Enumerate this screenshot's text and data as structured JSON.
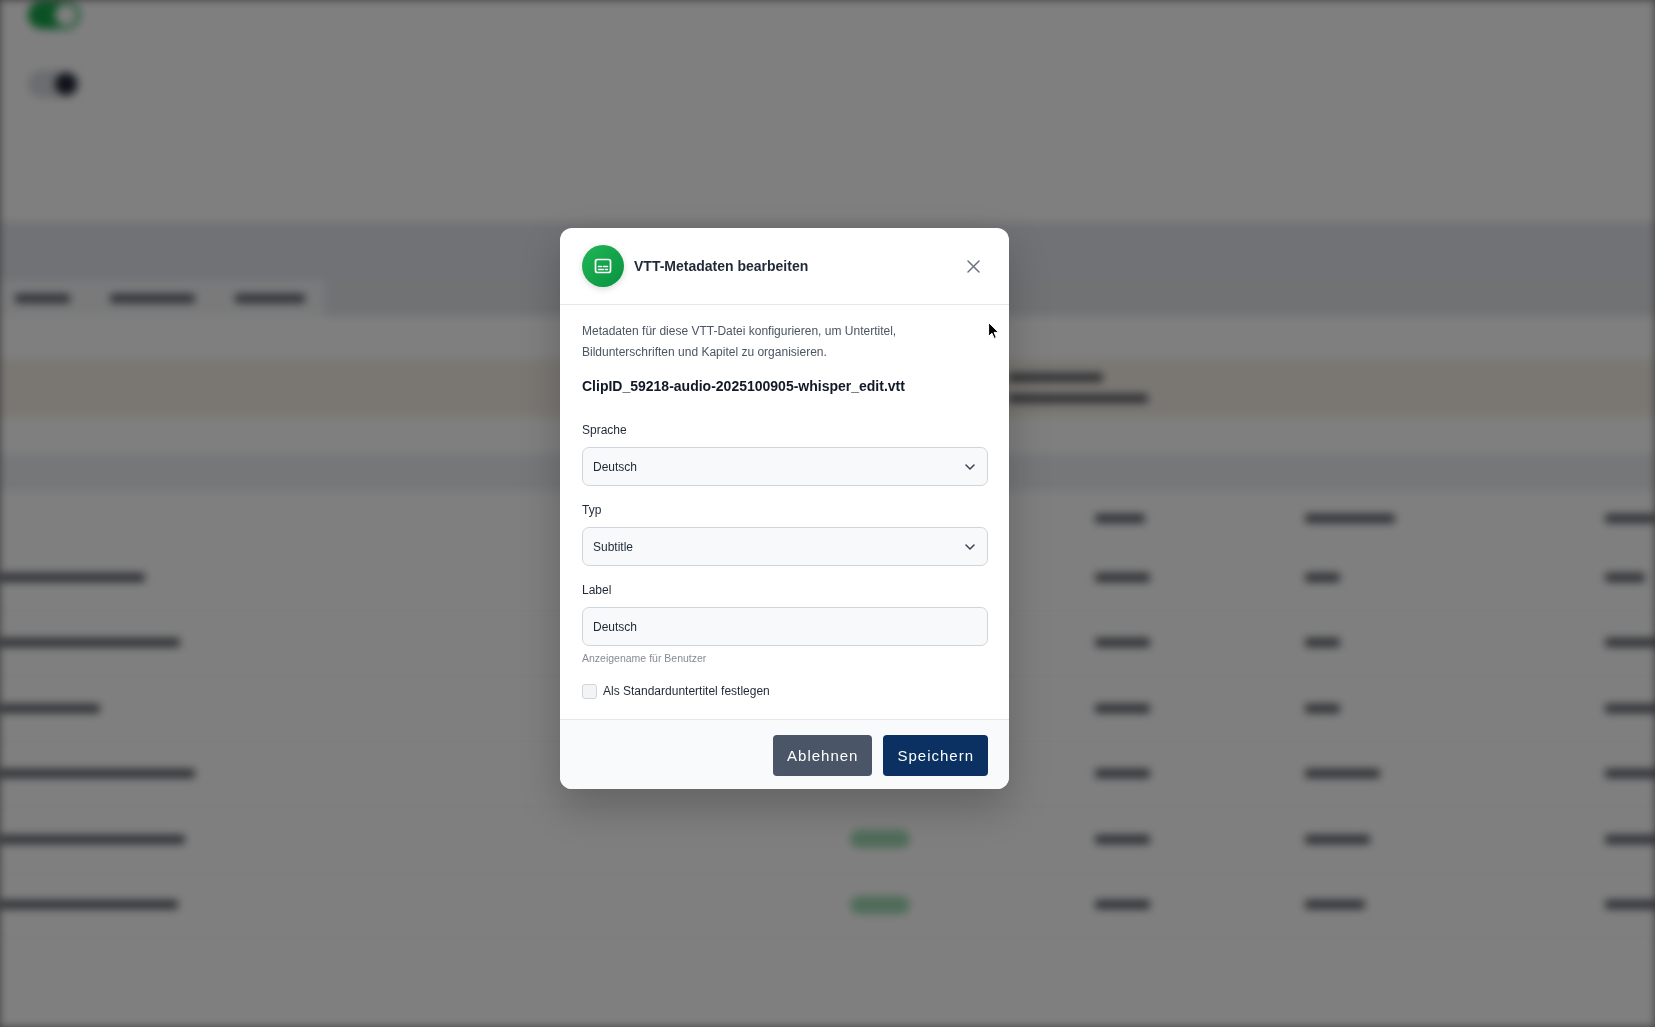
{
  "dialog": {
    "title": "VTT-Metadaten bearbeiten",
    "description": "Metadaten für diese VTT-Datei konfigurieren, um Untertitel, Bildunterschriften und Kapitel zu organisieren.",
    "filename": "ClipID_59218-audio-2025100905-whisper_edit.vtt",
    "fields": [
      {
        "kind": "select",
        "label": "Sprache",
        "value": "Deutsch"
      },
      {
        "kind": "select",
        "label": "Typ",
        "value": "Subtitle"
      },
      {
        "kind": "text",
        "label": "Label",
        "value": "Deutsch",
        "hint": "Anzeigename für Benutzer"
      }
    ],
    "checkbox": {
      "label": "Als Standarduntertitel festlegen",
      "checked": false
    },
    "buttons": [
      {
        "kind": "secondary",
        "label": "Ablehnen"
      },
      {
        "kind": "primary",
        "label": "Speichern"
      }
    ]
  }
}
